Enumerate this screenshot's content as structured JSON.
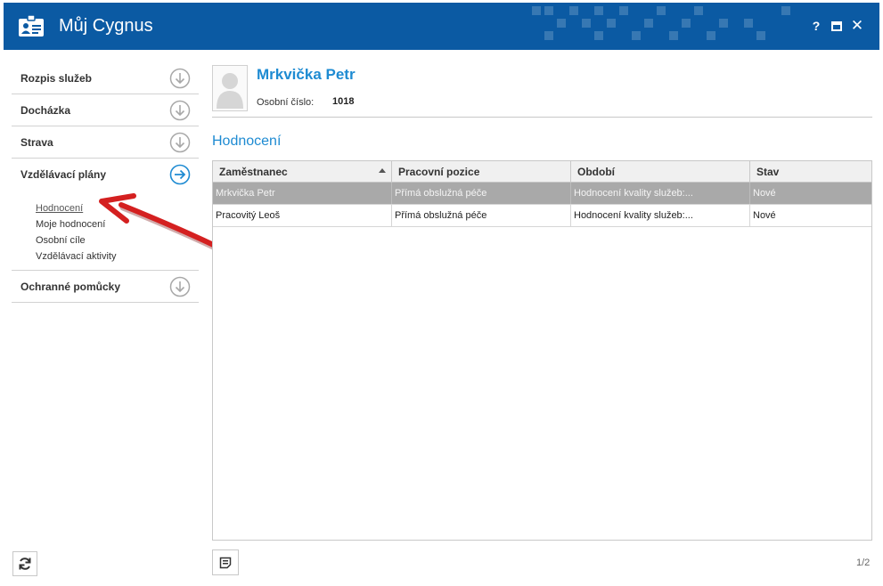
{
  "window": {
    "title": "Můj Cygnus",
    "help_label": "?",
    "close_label": "✕",
    "accent_color": "#0b5aa3"
  },
  "sidebar": {
    "items": [
      {
        "label": "Rozpis služeb",
        "icon": "chevron-down-circle-icon"
      },
      {
        "label": "Docházka",
        "icon": "chevron-down-circle-icon"
      },
      {
        "label": "Strava",
        "icon": "chevron-down-circle-icon"
      },
      {
        "label": "Vzdělávací plány",
        "icon": "arrow-right-circle-icon"
      },
      {
        "label": "Ochranné pomůcky",
        "icon": "chevron-down-circle-icon"
      }
    ],
    "subitems": [
      {
        "label": "Hodnocení",
        "active": true
      },
      {
        "label": "Moje hodnocení"
      },
      {
        "label": "Osobní cíle"
      },
      {
        "label": "Vzdělávací aktivity"
      }
    ]
  },
  "profile": {
    "name": "Mrkvička Petr",
    "personal_number_label": "Osobní číslo:",
    "personal_number": "1018"
  },
  "section": {
    "title": "Hodnocení"
  },
  "table": {
    "columns": [
      "Zaměstnanec",
      "Pracovní pozice",
      "Období",
      "Stav"
    ],
    "sort_column": "Zaměstnanec",
    "rows": [
      {
        "employee": "Mrkvička Petr",
        "position": "Přímá obslužná péče",
        "period": "Hodnocení kvality služeb:...",
        "status": "Nové",
        "selected": true
      },
      {
        "employee": "Pracovitý Leoš",
        "position": "Přímá obslužná péče",
        "period": "Hodnocení kvality služeb:...",
        "status": "Nové"
      }
    ]
  },
  "pager": {
    "text": "1/2"
  },
  "colors": {
    "accent_blue": "#1e8bd2",
    "selected_row": "#a9a9a9",
    "annotation_arrow": "#d42020"
  }
}
